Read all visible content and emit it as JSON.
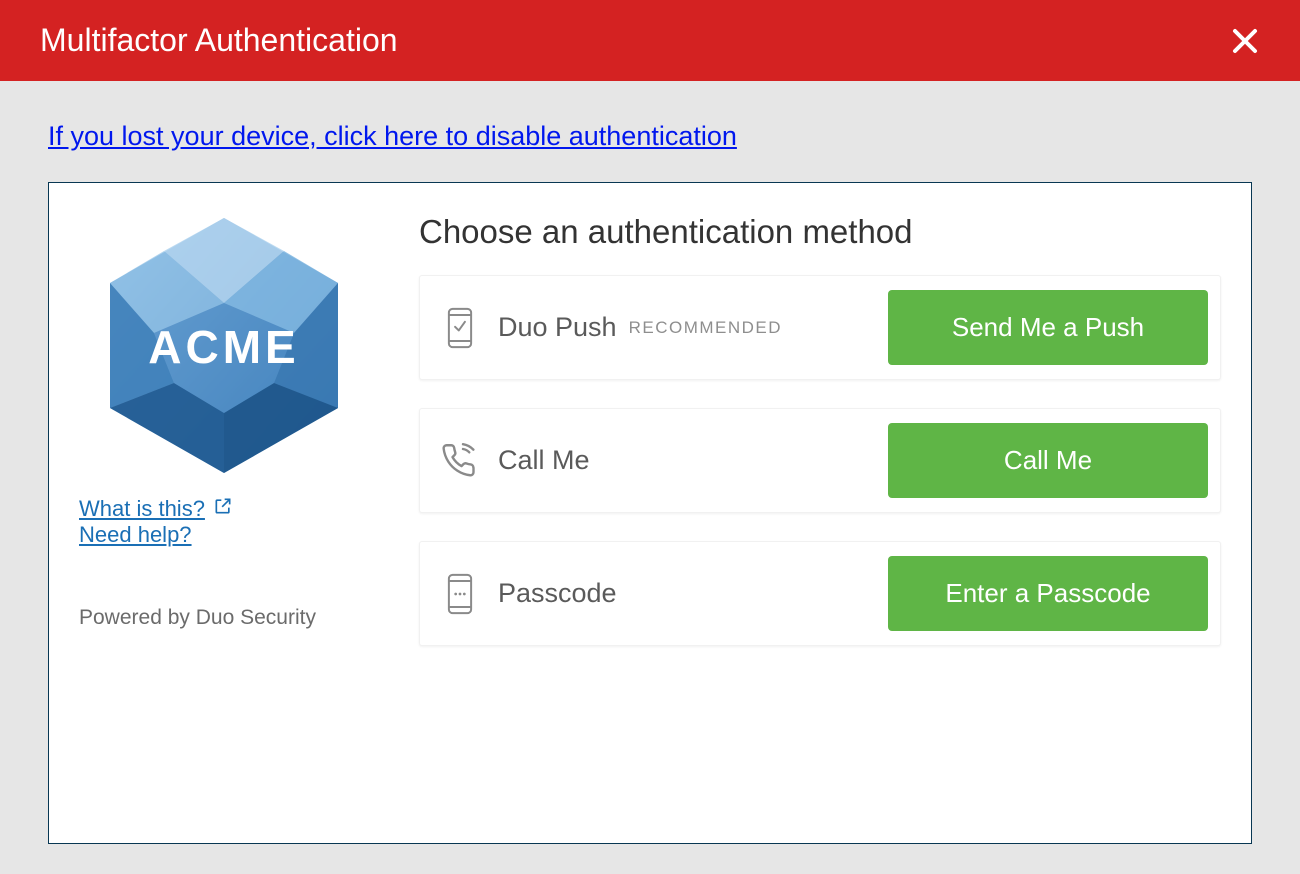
{
  "header": {
    "title": "Multifactor Authentication"
  },
  "lost_device_link": "If you lost your device, click here to disable authentication",
  "left": {
    "logo_text": "ACME",
    "what_is_this": "What is this?",
    "need_help": "Need help?",
    "powered": "Powered by Duo Security"
  },
  "main": {
    "prompt": "Choose an authentication method",
    "methods": [
      {
        "label": "Duo Push",
        "badge": "RECOMMENDED",
        "button": "Send Me a Push"
      },
      {
        "label": "Call Me",
        "badge": "",
        "button": "Call Me"
      },
      {
        "label": "Passcode",
        "badge": "",
        "button": "Enter a Passcode"
      }
    ]
  }
}
